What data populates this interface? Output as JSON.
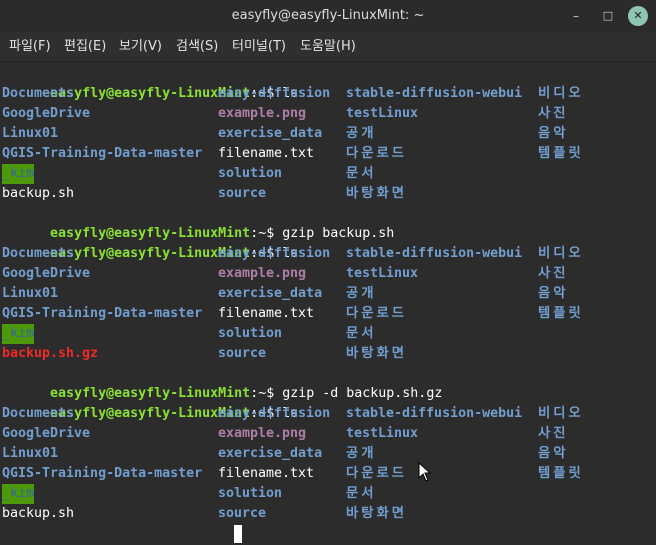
{
  "window": {
    "title": "easyfly@easyfly-LinuxMint: ~",
    "minimize_glyph": "–",
    "maximize_glyph": "□",
    "close_glyph": "✕"
  },
  "menu": {
    "file": "파일(F)",
    "edit": "편집(E)",
    "view": "보기(V)",
    "search": "검색(S)",
    "terminal": "터미널(T)",
    "help": "도움말(H)"
  },
  "terminal": {
    "prompt": "easyfly@easyfly-LinuxMint",
    "prompt_sep": ":~$ ",
    "commands": [
      "ls",
      "gzip backup.sh",
      "ls",
      "gzip -d backup.sh.gz",
      "ls"
    ],
    "listing1": {
      "col1": [
        "Documents",
        "GoogleDrive",
        "Linux01",
        "QGIS-Training-Data-master",
        "_kim",
        "backup.sh"
      ],
      "col2": [
        "easy-diffusion",
        "example.png",
        "exercise_data",
        "filename.txt",
        "solution",
        "source"
      ],
      "col3": [
        "stable-diffusion-webui",
        "testLinux",
        "공개",
        "다운로드",
        "문서",
        "바탕화면"
      ],
      "col4": [
        "비디오",
        "사진",
        "음악",
        "템플릿"
      ]
    },
    "listing2": {
      "col1": [
        "Documents",
        "GoogleDrive",
        "Linux01",
        "QGIS-Training-Data-master",
        "_kim",
        "backup.sh.gz"
      ],
      "col2": [
        "easy-diffusion",
        "example.png",
        "exercise_data",
        "filename.txt",
        "solution",
        "source"
      ],
      "col3": [
        "stable-diffusion-webui",
        "testLinux",
        "공개",
        "다운로드",
        "문서",
        "바탕화면"
      ],
      "col4": [
        "비디오",
        "사진",
        "음악",
        "템플릿"
      ]
    },
    "listing3": {
      "col1": [
        "Documents",
        "GoogleDrive",
        "Linux01",
        "QGIS-Training-Data-master",
        "_kim",
        "backup.sh"
      ],
      "col2": [
        "easy-diffusion",
        "example.png",
        "exercise_data",
        "filename.txt",
        "solution",
        "source"
      ],
      "col3": [
        "stable-diffusion-webui",
        "testLinux",
        "공개",
        "다운로드",
        "문서",
        "바탕화면"
      ],
      "col4": [
        "비디오",
        "사진",
        "음악",
        "템플릿"
      ]
    }
  },
  "colors": {
    "prompt": "#8ae234",
    "directory": "#729fcf",
    "image_file": "#ad7fa8",
    "archive": "#ef2929",
    "highlight_bg": "#4e9a06"
  }
}
